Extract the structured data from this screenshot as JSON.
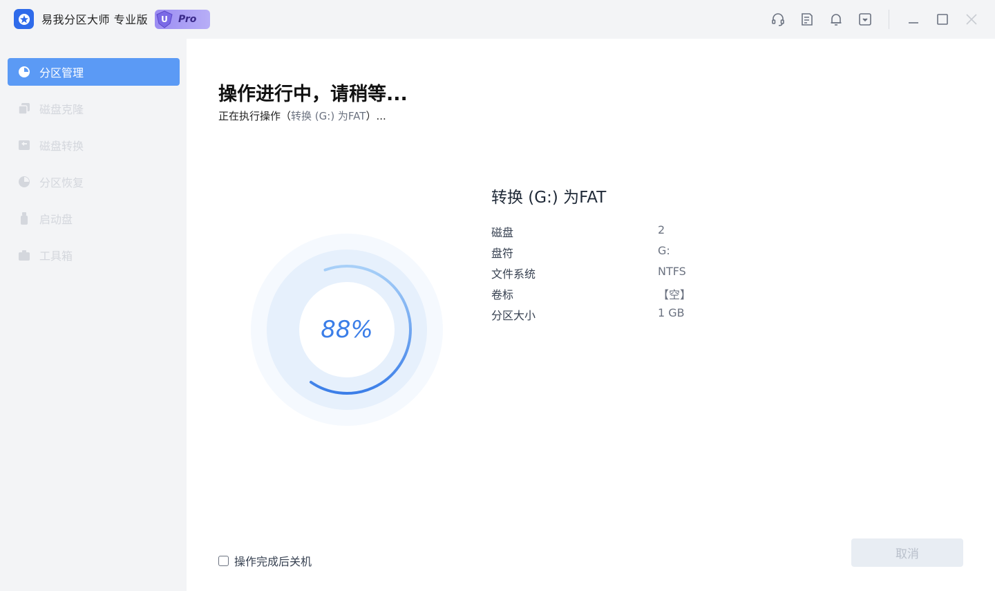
{
  "window": {
    "title": "易我分区大师 专业版",
    "badge_letter": "U",
    "badge_text": "Pro",
    "icons": [
      "headset-icon",
      "notes-icon",
      "bell-icon",
      "dropdown-box-icon"
    ],
    "controls": [
      "minimize-icon",
      "maximize-icon",
      "close-icon"
    ]
  },
  "sidebar": {
    "items": [
      {
        "label": "分区管理",
        "icon": "pie-chart-icon",
        "state": "active"
      },
      {
        "label": "磁盘克隆",
        "icon": "disk-clone-icon",
        "state": "disabled"
      },
      {
        "label": "磁盘转换",
        "icon": "disk-convert-icon",
        "state": "disabled"
      },
      {
        "label": "分区恢复",
        "icon": "partition-recovery-icon",
        "state": "disabled"
      },
      {
        "label": "启动盘",
        "icon": "usb-drive-icon",
        "state": "disabled"
      },
      {
        "label": "工具箱",
        "icon": "toolbox-icon",
        "state": "disabled"
      }
    ]
  },
  "main": {
    "title": "操作进行中，请稍等...",
    "sub_prefix": "正在执行操作（",
    "sub_op": "转换 (G:) 为FAT",
    "sub_suffix": "）...",
    "progress": {
      "percent_label": "88%",
      "value": 0.88
    },
    "details": {
      "title": "转换 (G:) 为FAT",
      "rows": [
        {
          "key": "磁盘",
          "value": "2"
        },
        {
          "key": "盘符",
          "value": "G:"
        },
        {
          "key": "文件系统",
          "value": "NTFS"
        },
        {
          "key": "卷标",
          "value": "【空】"
        },
        {
          "key": "分区大小",
          "value": "1 GB"
        }
      ]
    },
    "shutdown_label": "操作完成后关机",
    "cancel_label": "取消"
  },
  "colors": {
    "accent": "#5b9af5",
    "ring_progress": "#3b7ee8",
    "ring_track": "#dcebfb",
    "disabled_text": "#d4d7dd"
  }
}
